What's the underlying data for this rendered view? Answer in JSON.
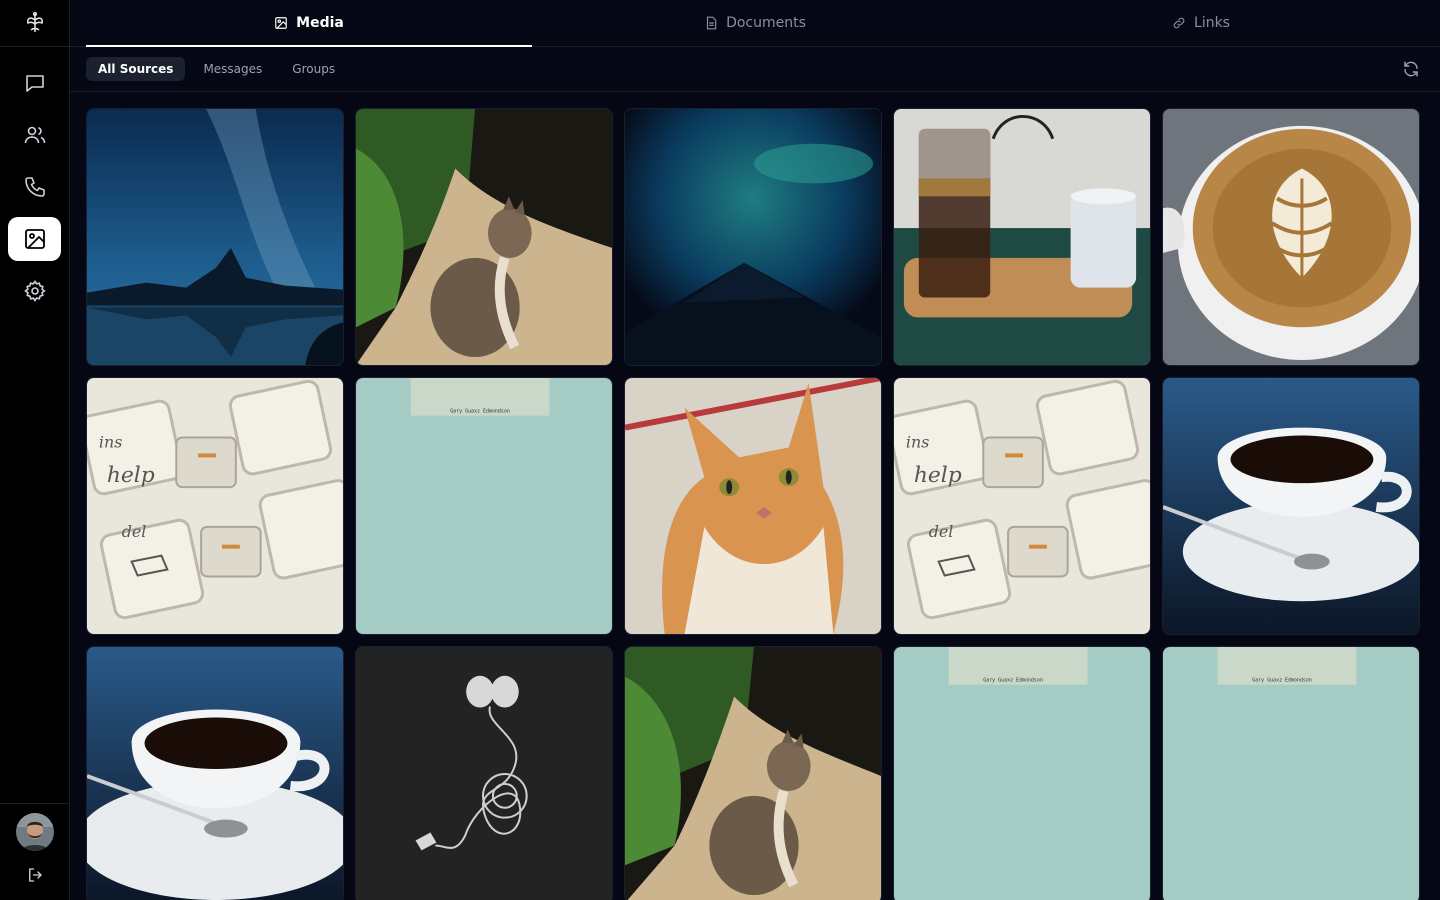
{
  "sidebar": {
    "nav": [
      {
        "icon": "chat-icon",
        "active": false
      },
      {
        "icon": "users-icon",
        "active": false
      },
      {
        "icon": "phone-icon",
        "active": false
      },
      {
        "icon": "image-icon",
        "active": true
      },
      {
        "icon": "gear-icon",
        "active": false
      }
    ]
  },
  "tabs": [
    {
      "label": "Media",
      "icon": "image-icon",
      "active": true
    },
    {
      "label": "Documents",
      "icon": "document-icon",
      "active": false
    },
    {
      "label": "Links",
      "icon": "link-icon",
      "active": false
    }
  ],
  "filters": [
    {
      "label": "All Sources",
      "active": true
    },
    {
      "label": "Messages",
      "active": false
    },
    {
      "label": "Groups",
      "active": false
    }
  ],
  "media": [
    {
      "subject": "milky-way-mountain-lake"
    },
    {
      "subject": "cat-looking-up"
    },
    {
      "subject": "aurora-night-sky"
    },
    {
      "subject": "coffee-pour-over"
    },
    {
      "subject": "latte-art"
    },
    {
      "subject": "keyboard-keys"
    },
    {
      "subject": "paper-note",
      "caption": "Gary Guaxz Edmondson"
    },
    {
      "subject": "orange-cat"
    },
    {
      "subject": "keyboard-keys"
    },
    {
      "subject": "black-coffee-cup"
    },
    {
      "subject": "black-coffee-cup"
    },
    {
      "subject": "earphone-drawing"
    },
    {
      "subject": "cat-looking-up"
    },
    {
      "subject": "paper-note",
      "caption": "Gary Guaxz Edmondson"
    },
    {
      "subject": "paper-note",
      "caption": "Gary Guaxz Edmondson"
    }
  ],
  "keycaps": {
    "ins": "ins",
    "help": "help",
    "del": "del"
  },
  "colors": {
    "bg": "#050814",
    "sidebar": "#000000",
    "active": "#ffffff"
  }
}
